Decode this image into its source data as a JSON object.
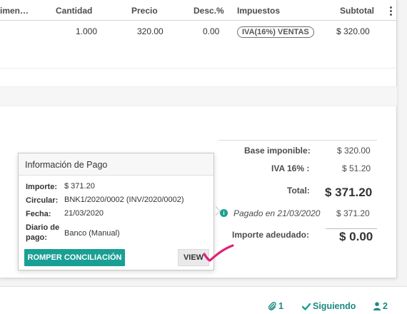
{
  "table": {
    "headers": {
      "cut_first": "imen…",
      "quantity": "Cantidad",
      "price": "Precio",
      "discount": "Desc.%",
      "taxes": "Impuestos",
      "subtotal": "Subtotal"
    },
    "rows": [
      {
        "quantity": "1.000",
        "price": "320.00",
        "discount": "0.00",
        "tax": "IVA(16%) VENTAS",
        "subtotal": "$ 320.00"
      }
    ]
  },
  "totals": {
    "base_label": "Base imponible:",
    "base_value": "$ 320.00",
    "iva_label": "IVA 16% :",
    "iva_value": "$ 51.20",
    "total_label": "Total:",
    "total_value": "$ 371.20",
    "paid_text": "Pagado en 21/03/2020",
    "paid_value": "$ 371.20",
    "due_label": "Importe adeudado:",
    "due_value": "$ 0.00"
  },
  "payment_popover": {
    "title": "Información de Pago",
    "fields": [
      {
        "label": "Importe:",
        "value": "$ 371.20"
      },
      {
        "label": "Circular:",
        "value": "BNK1/2020/0002 (INV/2020/0002)"
      },
      {
        "label": "Fecha:",
        "value": "21/03/2020"
      },
      {
        "label_line1": "Diario de",
        "label_line2": "pago:",
        "value": "Banco (Manual)"
      }
    ],
    "unreconcile_label": "ROMPER CONCILIACIÓN",
    "view_label": "VIEW"
  },
  "chatter": {
    "attachments_count": "1",
    "following_label": "Siguiendo",
    "followers_count": "2"
  },
  "colors": {
    "accent": "#1a9f94",
    "pen_mark": "#e0207a"
  },
  "icons": {
    "info": "info-circle-icon",
    "paperclip": "paperclip-icon",
    "check": "check-icon",
    "user": "user-icon"
  }
}
